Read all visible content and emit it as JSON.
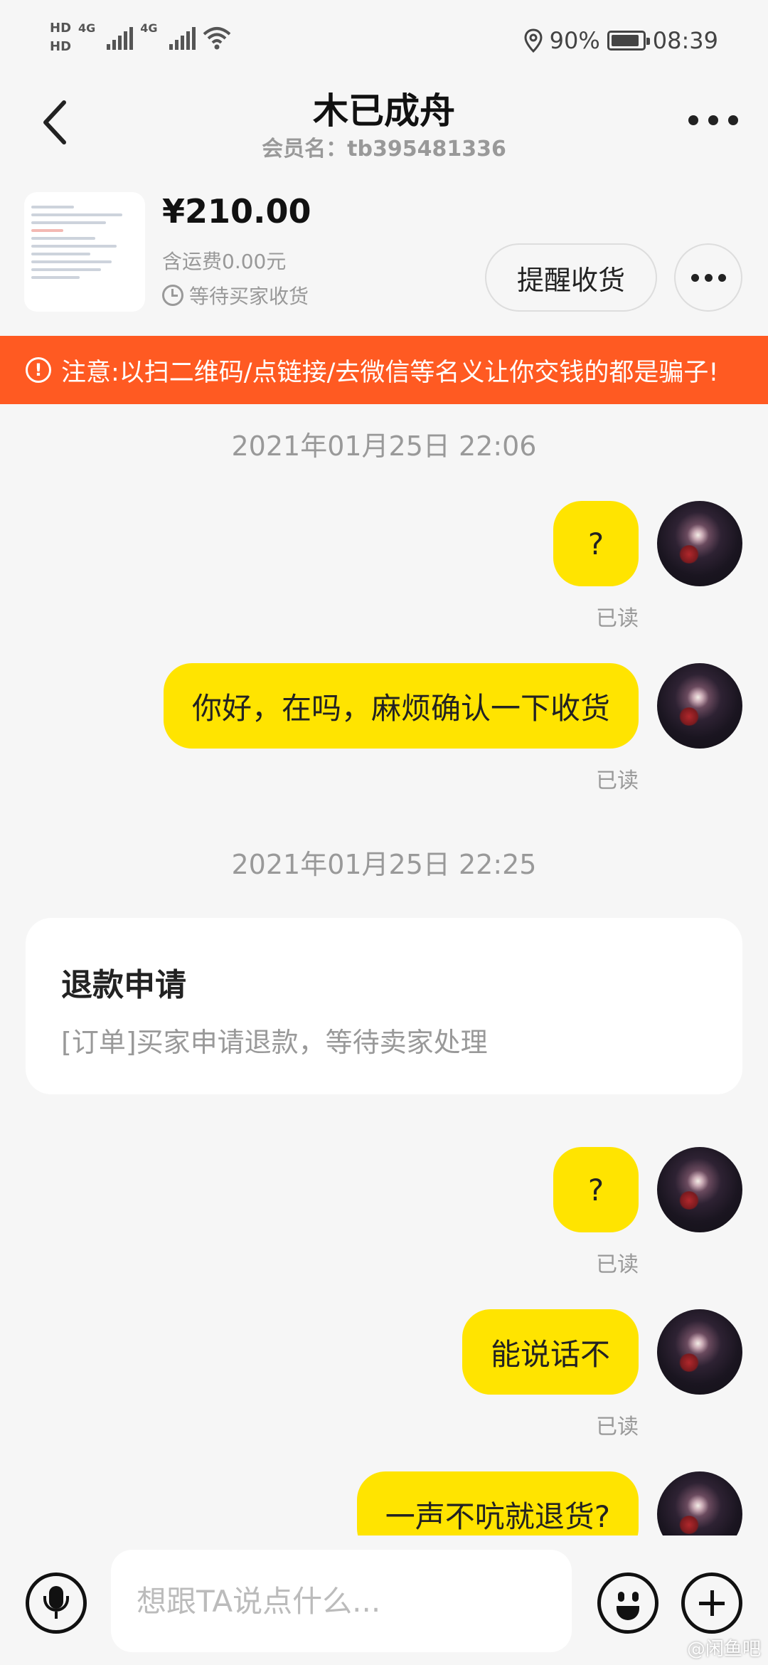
{
  "status_bar": {
    "hd1": "HD",
    "hd2": "HD",
    "net1": "4G",
    "net2": "4G",
    "battery_pct": "90%",
    "battery_level": 0.9,
    "time": "08:39"
  },
  "header": {
    "title": "木已成舟",
    "subtitle": "会员名：tb395481336"
  },
  "order": {
    "price": "¥210.00",
    "shipping": "含运费0.00元",
    "status": "等待买家收货",
    "remind_button": "提醒收货"
  },
  "warning": {
    "text": "注意:以扫二维码/点链接/去微信等名义让你交钱的都是骗子!"
  },
  "chat": {
    "timestamp_1": "2021年01月25日 22:06",
    "timestamp_2": "2021年01月25日 22:25",
    "messages": [
      {
        "text": "?",
        "status": "已读"
      },
      {
        "text": "你好，在吗，麻烦确认一下收货",
        "status": "已读"
      },
      {
        "text": "?",
        "status": "已读"
      },
      {
        "text": "能说话不",
        "status": "已读"
      },
      {
        "text": "一声不吭就退货?"
      }
    ],
    "refund_card": {
      "title": "退款申请",
      "description": "[订单]买家申请退款，等待卖家处理"
    }
  },
  "input": {
    "placeholder": "想跟TA说点什么..."
  },
  "watermark": "@闲鱼吧",
  "colors": {
    "accent_yellow": "#ffe400",
    "warning_orange": "#ff5a22",
    "background": "#f6f6f6"
  }
}
